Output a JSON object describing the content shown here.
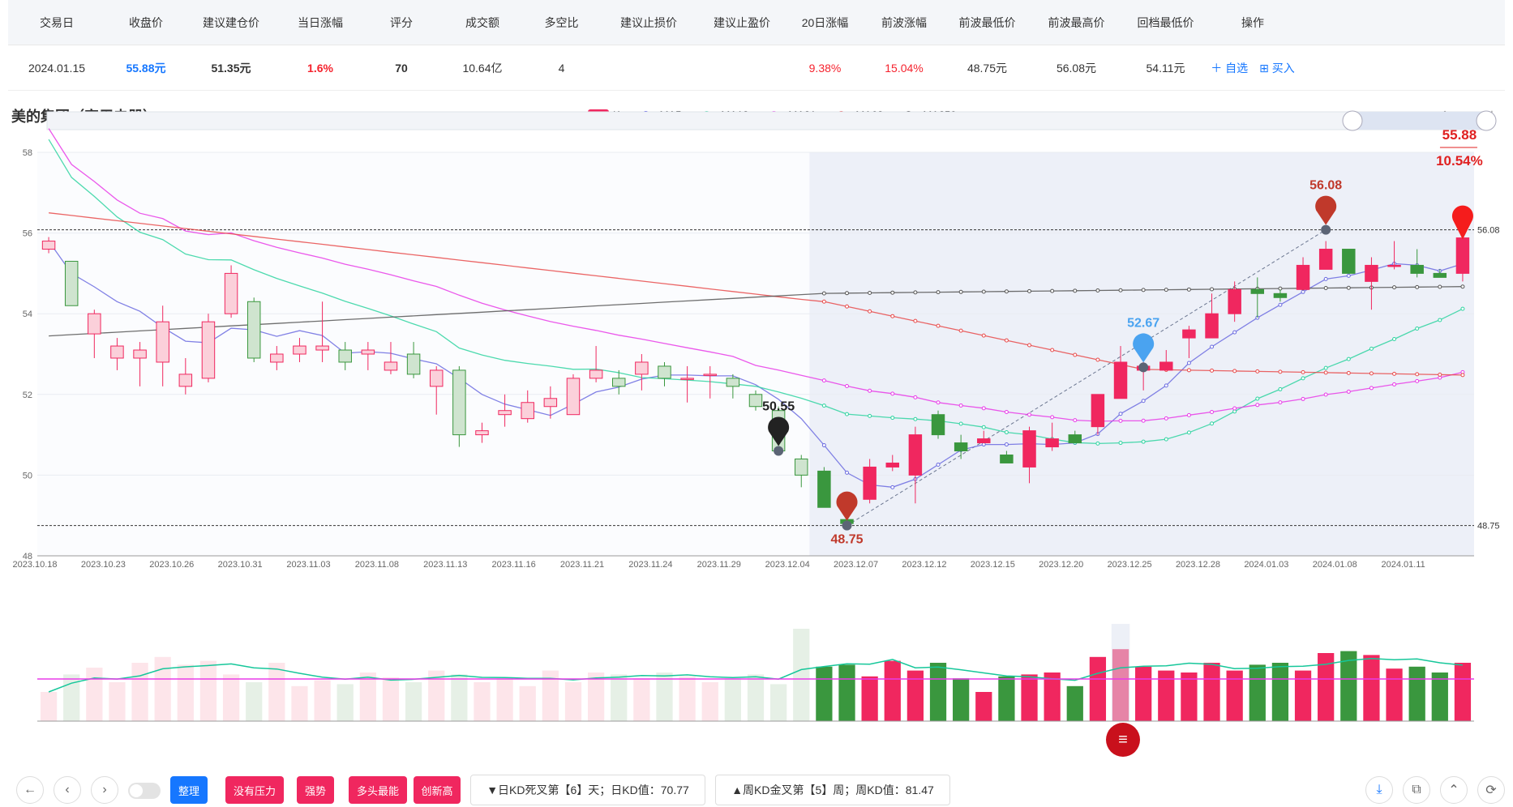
{
  "summary": {
    "headers": [
      "交易日",
      "收盘价",
      "建议建仓价",
      "当日涨幅",
      "评分",
      "成交额",
      "多空比",
      "建议止损价",
      "建议止盈价",
      "20日涨幅",
      "前波涨幅",
      "前波最低价",
      "前波最高价",
      "回档最低价",
      "操作"
    ],
    "trade_date": "2024.01.15",
    "close": "55.88元",
    "entry_price": "51.35元",
    "day_change": "1.6%",
    "score": "70",
    "turnover": "10.64亿",
    "long_short": "4",
    "stop_loss": "",
    "take_profit": "",
    "change_20d": "9.38%",
    "prev_wave_change": "15.04%",
    "prev_wave_low": "48.75元",
    "prev_wave_high": "56.08元",
    "pullback_low": "54.11元",
    "op_watch": "＋ 自选",
    "op_buy": "⊞ 买入"
  },
  "chart_title": "美的集团（家用电器）",
  "legend": [
    {
      "label": "K",
      "color": "#f0275f"
    },
    {
      "label": "MA5",
      "color": "#2222dd"
    },
    {
      "label": "MA18",
      "color": "#2ed3a0"
    },
    {
      "label": "MA31",
      "color": "#e83be8"
    },
    {
      "label": "MA63",
      "color": "#e83b3b"
    },
    {
      "label": "MA250",
      "color": "#222222"
    }
  ],
  "colors": {
    "up": "#f0275f",
    "down": "#3a973e",
    "up_faded": "#fde5ea",
    "down_faded": "#e6f0e6"
  },
  "chart_data": {
    "type": "candlestick",
    "ylim": [
      48,
      58
    ],
    "yticks": [
      "58",
      "56",
      "54",
      "52",
      "50",
      "48"
    ],
    "xticks": [
      "2023.10.18",
      "2023.10.23",
      "2023.10.26",
      "2023.10.31",
      "2023.11.03",
      "2023.11.08",
      "2023.11.13",
      "2023.11.16",
      "2023.11.21",
      "2023.11.24",
      "2023.11.29",
      "2023.12.04",
      "2023.12.07",
      "2023.12.12",
      "2023.12.15",
      "2023.12.20",
      "2023.12.25",
      "2023.12.28",
      "2024.01.03",
      "2024.01.08",
      "2024.01.11"
    ],
    "candles": [
      [
        55.6,
        55.8,
        55.5,
        55.9
      ],
      [
        55.3,
        54.2,
        54.2,
        55.3
      ],
      [
        53.5,
        54.0,
        52.9,
        54.1
      ],
      [
        52.9,
        53.2,
        52.6,
        53.4
      ],
      [
        52.9,
        53.1,
        52.2,
        53.3
      ],
      [
        52.8,
        53.8,
        52.2,
        54.2
      ],
      [
        52.2,
        52.5,
        52.0,
        52.9
      ],
      [
        52.4,
        53.8,
        52.3,
        54.0
      ],
      [
        54.0,
        55.0,
        53.9,
        55.2
      ],
      [
        54.3,
        52.9,
        52.8,
        54.4
      ],
      [
        52.8,
        53.0,
        52.6,
        53.2
      ],
      [
        53.0,
        53.2,
        52.8,
        53.4
      ],
      [
        53.1,
        53.2,
        52.8,
        54.3
      ],
      [
        53.1,
        52.8,
        52.6,
        53.3
      ],
      [
        53.0,
        53.1,
        52.6,
        53.3
      ],
      [
        52.6,
        52.8,
        52.5,
        53.3
      ],
      [
        53.0,
        52.5,
        52.4,
        53.3
      ],
      [
        52.2,
        52.6,
        51.5,
        52.7
      ],
      [
        52.6,
        51.0,
        50.7,
        52.7
      ],
      [
        51.0,
        51.1,
        50.8,
        51.3
      ],
      [
        51.5,
        51.6,
        51.2,
        52.0
      ],
      [
        51.4,
        51.8,
        51.3,
        52.1
      ],
      [
        51.7,
        51.9,
        51.4,
        52.2
      ],
      [
        51.5,
        52.4,
        51.5,
        52.5
      ],
      [
        52.4,
        52.6,
        52.3,
        53.2
      ],
      [
        52.4,
        52.2,
        52.0,
        52.6
      ],
      [
        52.5,
        52.8,
        52.1,
        53.0
      ],
      [
        52.7,
        52.4,
        52.2,
        52.8
      ],
      [
        52.4,
        52.4,
        51.8,
        52.7
      ],
      [
        52.5,
        52.5,
        51.9,
        52.7
      ],
      [
        52.4,
        52.2,
        51.9,
        52.5
      ],
      [
        52.0,
        51.7,
        51.6,
        52.1
      ],
      [
        51.6,
        50.6,
        50.5,
        51.7
      ],
      [
        50.4,
        50.0,
        49.7,
        50.5
      ],
      [
        50.1,
        49.2,
        49.2,
        50.2
      ],
      [
        48.9,
        48.8,
        48.75,
        49.2
      ],
      [
        49.4,
        50.2,
        49.3,
        50.4
      ],
      [
        50.2,
        50.3,
        50.1,
        50.5
      ],
      [
        50.0,
        51.0,
        49.3,
        51.2
      ],
      [
        51.5,
        51.0,
        50.9,
        51.6
      ],
      [
        50.8,
        50.6,
        50.4,
        51.0
      ],
      [
        50.8,
        50.9,
        50.8,
        51.1
      ],
      [
        50.5,
        50.3,
        50.3,
        50.6
      ],
      [
        50.2,
        51.1,
        49.8,
        51.2
      ],
      [
        50.7,
        50.9,
        50.6,
        51.3
      ],
      [
        51.0,
        50.8,
        50.8,
        51.1
      ],
      [
        51.2,
        52.0,
        51.0,
        52.0
      ],
      [
        51.9,
        52.8,
        51.9,
        53.2
      ],
      [
        52.6,
        52.7,
        52.1,
        52.8
      ],
      [
        52.6,
        52.8,
        52.6,
        53.1
      ],
      [
        53.4,
        53.6,
        52.9,
        53.7
      ],
      [
        53.4,
        54.0,
        53.4,
        54.5
      ],
      [
        54.0,
        54.6,
        53.8,
        54.8
      ],
      [
        54.6,
        54.5,
        53.9,
        54.9
      ],
      [
        54.5,
        54.4,
        54.3,
        54.6
      ],
      [
        54.6,
        55.2,
        54.6,
        55.4
      ],
      [
        55.1,
        55.6,
        55.1,
        55.8
      ],
      [
        55.6,
        55.0,
        55.0,
        55.6
      ],
      [
        54.8,
        55.2,
        54.1,
        55.4
      ],
      [
        55.2,
        55.2,
        55.1,
        55.8
      ],
      [
        55.2,
        55.0,
        54.9,
        55.6
      ],
      [
        55.0,
        54.9,
        54.9,
        55.1
      ],
      [
        55.0,
        55.88,
        54.8,
        56.2
      ]
    ],
    "markers": {
      "low": "48.75",
      "high": "56.08",
      "mid": "52.67",
      "black": "50.55",
      "last": "55.88",
      "last_pct": "10.54%"
    },
    "ref_lines": {
      "high": "56.08",
      "low": "48.75"
    }
  },
  "toolbar": {
    "tags": [
      "整理",
      "没有压力",
      "强势",
      "多头最能",
      "创新高"
    ],
    "daily_kd": "▼日KD死叉第【6】天；日KD值：70.77",
    "weekly_kd": "▲周KD金叉第【5】周；周KD值：81.47"
  }
}
